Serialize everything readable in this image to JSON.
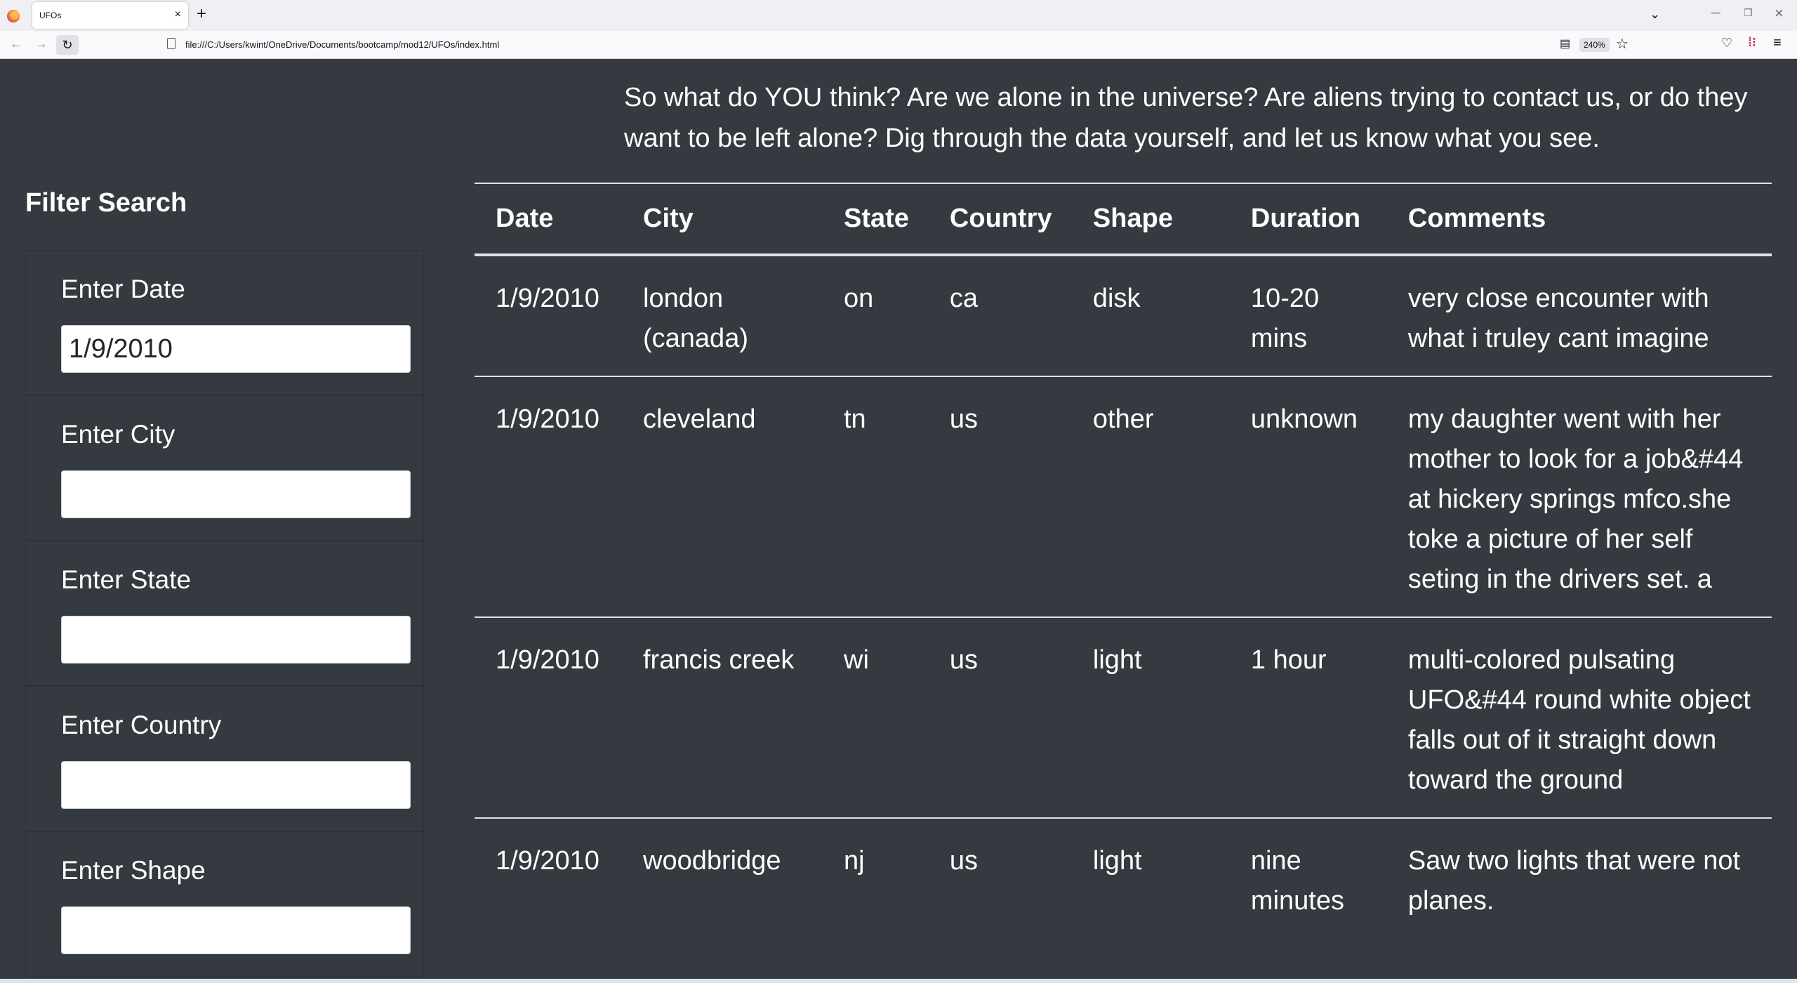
{
  "browser": {
    "tab_title": "UFOs",
    "tab_close": "×",
    "new_tab": "+",
    "url": "file:///C:/Users/kwint/OneDrive/Documents/bootcamp/mod12/UFOs/index.html",
    "zoom": "240%"
  },
  "intro": {
    "text": "So what do YOU think? Are we alone in the universe? Are aliens trying to contact us, or do they want to be left alone? Dig through the data yourself, and let us know what you see."
  },
  "filter": {
    "heading": "Filter Search",
    "fields": [
      {
        "label": "Enter Date",
        "value": "1/9/2010"
      },
      {
        "label": "Enter City",
        "value": ""
      },
      {
        "label": "Enter State",
        "value": ""
      },
      {
        "label": "Enter Country",
        "value": ""
      },
      {
        "label": "Enter Shape",
        "value": ""
      }
    ]
  },
  "table": {
    "headers": [
      "Date",
      "City",
      "State",
      "Country",
      "Shape",
      "Duration",
      "Comments"
    ],
    "rows": [
      [
        "1/9/2010",
        "london (canada)",
        "on",
        "ca",
        "disk",
        "10-20 mins",
        "very close encounter with what i truley cant imagine"
      ],
      [
        "1/9/2010",
        "cleveland",
        "tn",
        "us",
        "other",
        "unknown",
        "my daughter went with her mother to look for a job&#44 at hickery springs mfco.she toke a picture of her self seting in the drivers set. a"
      ],
      [
        "1/9/2010",
        "francis creek",
        "wi",
        "us",
        "light",
        "1 hour",
        "multi-colored pulsating UFO&#44 round white object falls out of it straight down toward the ground"
      ],
      [
        "1/9/2010",
        "woodbridge",
        "nj",
        "us",
        "light",
        "nine minutes",
        "Saw two lights that were not planes."
      ]
    ]
  }
}
